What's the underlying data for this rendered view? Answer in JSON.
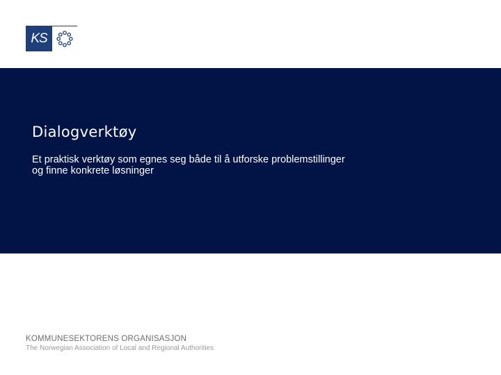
{
  "logo": {
    "text": "KS"
  },
  "banner": {
    "title": "Dialogverktøy",
    "subtitle_line1": "Et praktisk verktøy som egnes seg både til å utforske problemstillinger",
    "subtitle_line2": "og finne konkrete løsninger"
  },
  "footer": {
    "organization": "KOMMUNESEKTORENS ORGANISASJON",
    "english_name": "The Norwegian Association of Local and Regional Authorities"
  },
  "colors": {
    "banner_background": "#011445",
    "logo_blue": "#1f3f7a",
    "text_on_banner": "#ffffff"
  },
  "icons": {
    "logo_mark": "ring-of-circles-icon"
  }
}
